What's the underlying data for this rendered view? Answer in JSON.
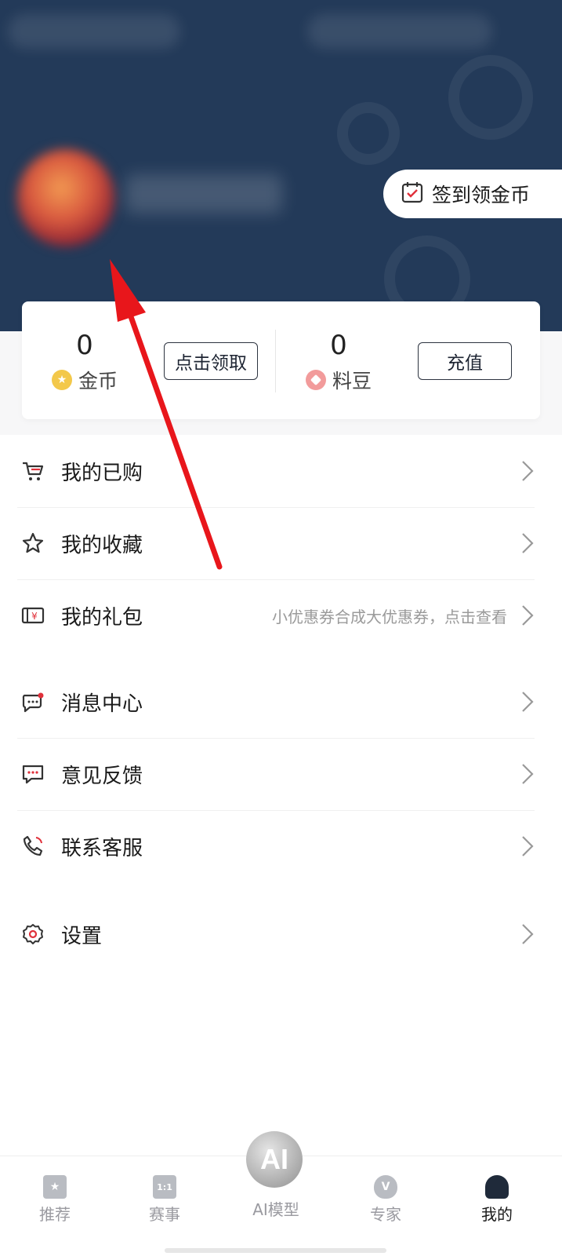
{
  "header": {
    "checkin_label": "签到领金币",
    "accent_bg": "#233a59"
  },
  "wallet": {
    "coins": {
      "value": "0",
      "label": "金币",
      "button": "点击领取"
    },
    "beans": {
      "value": "0",
      "label": "料豆",
      "button": "充值"
    }
  },
  "menu": [
    {
      "label": "我的已购",
      "icon": "cart-icon"
    },
    {
      "label": "我的收藏",
      "icon": "star-icon"
    },
    {
      "label": "我的礼包",
      "icon": "gift-ticket-icon",
      "hint": "小优惠券合成大优惠券，点击查看"
    },
    {
      "label": "消息中心",
      "icon": "message-icon"
    },
    {
      "label": "意见反馈",
      "icon": "feedback-icon"
    },
    {
      "label": "联系客服",
      "icon": "phone-icon"
    },
    {
      "label": "设置",
      "icon": "gear-icon"
    }
  ],
  "tabbar": {
    "tabs": [
      {
        "label": "推荐",
        "icon": "recommend-icon"
      },
      {
        "label": "赛事",
        "icon": "match-icon"
      },
      {
        "label": "AI模型",
        "icon": "ai-icon"
      },
      {
        "label": "专家",
        "icon": "expert-icon"
      },
      {
        "label": "我的",
        "icon": "profile-icon"
      }
    ],
    "ai_badge": "AI",
    "match_badge": "1:1",
    "expert_badge": "V"
  },
  "colors": {
    "annotation_arrow": "#e8161b"
  }
}
